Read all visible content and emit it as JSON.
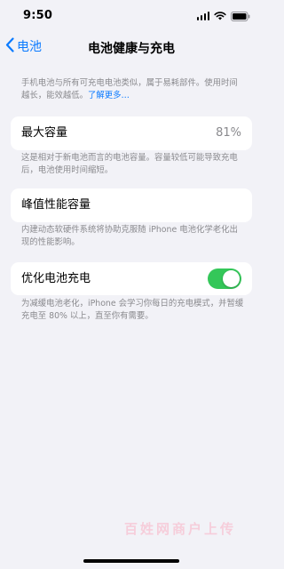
{
  "status_bar": {
    "time": "9:50",
    "icons": [
      "cellular-signal-icon",
      "wifi-icon",
      "battery-icon"
    ]
  },
  "nav": {
    "back_label": "电池",
    "title": "电池健康与充电"
  },
  "intro": {
    "text": "手机电池与所有可充电电池类似，属于易耗部件。使用时间越长，能效越低。",
    "link": "了解更多…"
  },
  "max_capacity": {
    "label": "最大容量",
    "value": "81%",
    "note": "这是相对于新电池而言的电池容量。容量较低可能导致充电后，电池使用时间缩短。"
  },
  "peak_performance": {
    "label": "峰值性能容量",
    "note": "内建动态软硬件系统将协助克服随 iPhone 电池化学老化出现的性能影响。"
  },
  "optimized_charging": {
    "label": "优化电池充电",
    "enabled": true,
    "note": "为减缓电池老化，iPhone 会学习你每日的充电模式，并暂缓充电至 80% 以上，直至你有需要。"
  },
  "watermark": "百姓网商户上传",
  "colors": {
    "accent": "#0a7aff",
    "toggle_on": "#34c759",
    "background": "#f2f2f7",
    "secondary_text": "#8a8a8e"
  }
}
